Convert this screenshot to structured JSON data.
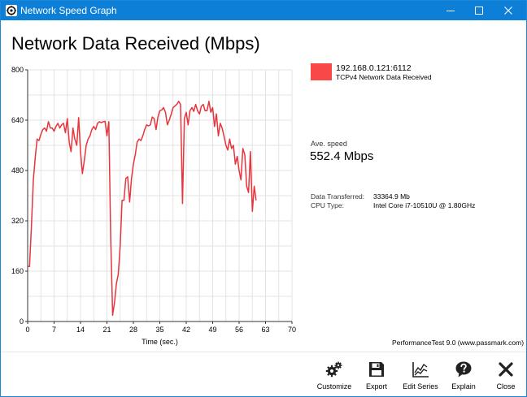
{
  "window": {
    "title": "Network Speed Graph",
    "accent_color": "#0e7fd6"
  },
  "heading": "Network Data Received (Mbps)",
  "legend": {
    "swatch_color": "#f84848",
    "series_name": "192.168.0.121:6112",
    "series_description": "TCPv4 Network Data Received"
  },
  "stats": {
    "avg_label": "Ave. speed",
    "avg_value": "552.4 Mbps",
    "data_transferred_label": "Data Transferred:",
    "data_transferred_value": "33364.9 Mb",
    "cpu_label": "CPU Type:",
    "cpu_value": "Intel Core i7-10510U @ 1.80GHz"
  },
  "footer": "PerformanceTest 9.0 (www.passmark.com)",
  "toolbar": {
    "customize": "Customize",
    "export": "Export",
    "edit_series": "Edit Series",
    "explain": "Explain",
    "close": "Close"
  },
  "chart_data": {
    "type": "line",
    "xlabel": "Time (sec.)",
    "ylabel": "",
    "xlim": [
      0,
      70
    ],
    "ylim": [
      0,
      800
    ],
    "xticks": [
      0,
      7,
      14,
      21,
      28,
      35,
      42,
      49,
      56,
      63,
      70
    ],
    "yticks": [
      0,
      160,
      320,
      480,
      640,
      800
    ],
    "grid": true,
    "color": "#e8343c",
    "x": [
      0,
      0.5,
      1,
      1.5,
      2,
      2.5,
      3,
      3.5,
      4,
      4.5,
      5,
      5.5,
      6,
      6.5,
      7,
      7.5,
      8,
      8.5,
      9,
      9.5,
      10,
      10.5,
      11,
      11.5,
      12,
      12.5,
      13,
      13.5,
      14,
      14.5,
      15,
      15.5,
      16,
      16.5,
      17,
      17.5,
      18,
      18.5,
      19,
      19.5,
      20,
      20.5,
      21,
      21.5,
      22,
      22.5,
      23,
      23.5,
      24,
      24.5,
      25,
      25.5,
      26,
      26.5,
      27,
      27.5,
      28,
      28.5,
      29,
      29.5,
      30,
      30.5,
      31,
      31.5,
      32,
      32.5,
      33,
      33.5,
      34,
      34.5,
      35,
      35.5,
      36,
      36.5,
      37,
      37.5,
      38,
      38.5,
      39,
      39.5,
      40,
      40.5,
      41,
      41.5,
      42,
      42.5,
      43,
      43.5,
      44,
      44.5,
      45,
      45.5,
      46,
      46.5,
      47,
      47.5,
      48,
      48.5,
      49,
      49.5,
      50,
      50.5,
      51,
      51.5,
      52,
      52.5,
      53,
      53.5,
      54,
      54.5,
      55,
      55.5,
      56,
      56.5,
      57,
      57.5,
      58,
      58.5,
      59,
      59.5,
      60,
      60.5
    ],
    "values": [
      175,
      175,
      300,
      450,
      520,
      580,
      575,
      595,
      610,
      615,
      605,
      635,
      615,
      615,
      605,
      620,
      630,
      615,
      625,
      630,
      600,
      645,
      570,
      540,
      615,
      580,
      560,
      648,
      540,
      470,
      510,
      560,
      580,
      590,
      610,
      620,
      610,
      630,
      635,
      632,
      635,
      636,
      590,
      635,
      270,
      20,
      60,
      120,
      150,
      240,
      385,
      385,
      455,
      460,
      380,
      455,
      500,
      530,
      570,
      580,
      575,
      590,
      610,
      625,
      622,
      625,
      650,
      645,
      610,
      650,
      670,
      672,
      680,
      665,
      625,
      640,
      658,
      680,
      685,
      690,
      700,
      690,
      375,
      645,
      665,
      625,
      670,
      680,
      668,
      690,
      670,
      660,
      684,
      690,
      670,
      670,
      700,
      665,
      680,
      620,
      660,
      590,
      630,
      615,
      590,
      560,
      545,
      580,
      550,
      560,
      500,
      525,
      480,
      450,
      550,
      530,
      430,
      410,
      540,
      350,
      430,
      385
    ]
  }
}
